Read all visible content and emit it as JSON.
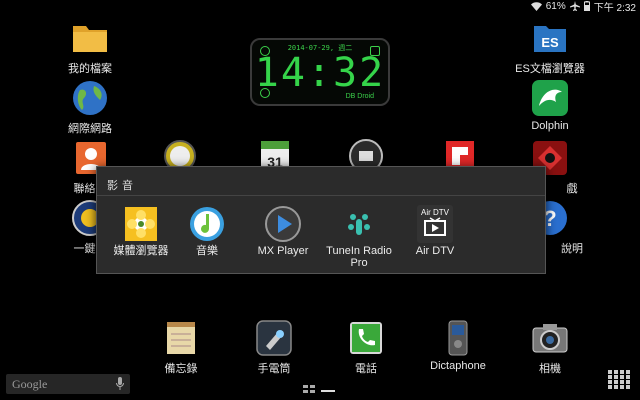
{
  "status": {
    "battery": "61%",
    "time": "下午 2:32"
  },
  "clock": {
    "date": "2014-07-29, 週二",
    "time": "14:32",
    "brand": "DB Droid"
  },
  "desktop": {
    "my_files": "我的檔案",
    "web": "網際網路",
    "contacts": "聯絡人",
    "wizard": "一鍵加",
    "es_explorer": "ES文檔瀏覽器",
    "dolphin": "Dolphin",
    "games": "戲",
    "help": "說明",
    "memo": "備忘錄",
    "flashlight": "手電筒",
    "phone": "電話",
    "dictaphone": "Dictaphone",
    "camera": "相機"
  },
  "folder": {
    "title": "影音",
    "apps": [
      {
        "label": "媒體瀏覽器"
      },
      {
        "label": "音樂"
      },
      {
        "label": "MX Player"
      },
      {
        "label": "TuneIn Radio Pro"
      },
      {
        "label": "Air DTV"
      }
    ]
  },
  "google": {
    "text": "Google"
  },
  "colors": {
    "clock_green": "#35d44a",
    "folder_bg": "#2b2b2b"
  }
}
